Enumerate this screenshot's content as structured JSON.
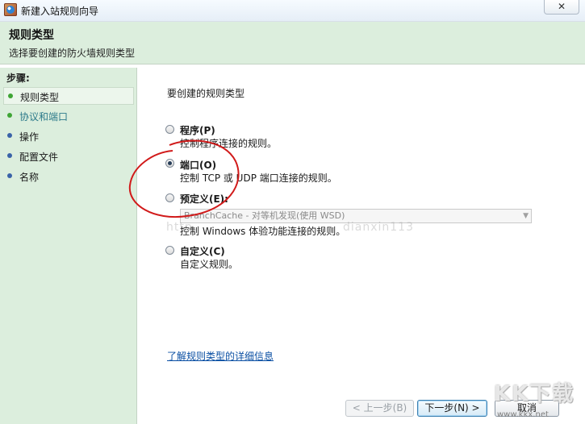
{
  "window": {
    "title": "新建入站规则向导",
    "close_label": "✕"
  },
  "header": {
    "title": "规则类型",
    "subtitle": "选择要创建的防火墙规则类型"
  },
  "steps": {
    "heading": "步骤:",
    "items": [
      {
        "label": "规则类型",
        "dot_color": "#3fa535"
      },
      {
        "label": "协议和端口",
        "dot_color": "#3fa535"
      },
      {
        "label": "操作",
        "dot_color": "#3a63a8"
      },
      {
        "label": "配置文件",
        "dot_color": "#3a63a8"
      },
      {
        "label": "名称",
        "dot_color": "#3a63a8"
      }
    ]
  },
  "content": {
    "question": "要创建的规则类型",
    "options": [
      {
        "label": "程序(P)",
        "description": "控制程序连接的规则。"
      },
      {
        "label": "端口(O)",
        "description": "控制 TCP 或 UDP 端口连接的规则。"
      },
      {
        "label": "预定义(E):",
        "description": "控制 Windows 体验功能连接的规则。",
        "select_value": "BranchCache - 对等机发现(使用 WSD)"
      },
      {
        "label": "自定义(C)",
        "description": "自定义规则。"
      }
    ],
    "selected_option": "端口(O)",
    "help_link": "了解规则类型的详细信息"
  },
  "buttons": {
    "back": "< 上一步(B)",
    "next": "下一步(N) >",
    "cancel": "取消"
  },
  "watermark": {
    "left": "http",
    "right": "dianxin113",
    "logo": "KK下载",
    "url": "www.kkx.net"
  },
  "annotation_color": "#d11a1a"
}
